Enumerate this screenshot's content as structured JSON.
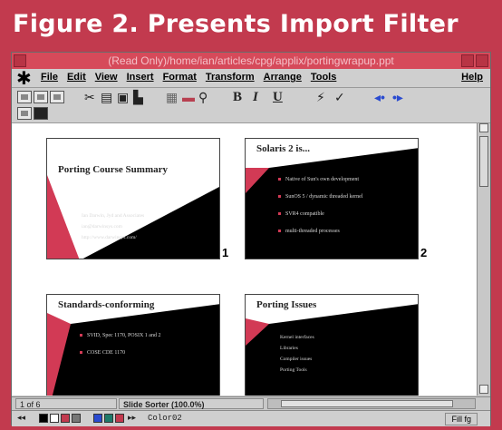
{
  "figure": {
    "title": "Figure 2. Presents Import Filter"
  },
  "window": {
    "title": "(Read Only)/home/ian/articles/cpg/applix/portingwrapup.ppt"
  },
  "menubar": {
    "items": [
      "File",
      "Edit",
      "View",
      "Insert",
      "Format",
      "Transform",
      "Arrange",
      "Tools"
    ],
    "help": "Help"
  },
  "toolbar": {
    "bold": "B",
    "italic": "I",
    "underline": "U"
  },
  "slides": [
    {
      "number": "1",
      "title": "Porting Course Summary",
      "lines": [
        "Ian Darwin, Jyd and Associates",
        "ian@darwinsys.com",
        "http://www.darwinsys.com/"
      ]
    },
    {
      "number": "2",
      "title": "Solaris 2 is...",
      "bullets": [
        "Native of Sun's own development",
        "SunOS 5 / dynamic threaded kernel",
        "SVR4 compatible",
        "multi-threaded processes"
      ]
    },
    {
      "number": "",
      "title": "Standards-conforming",
      "bullets": [
        "SVID, Spec 1170, POSIX 1 and 2",
        "COSE CDE 1170"
      ]
    },
    {
      "number": "",
      "title": "Porting Issues",
      "lines": [
        "Kernel interfaces",
        "Libraries",
        "Compiler issues",
        "Porting Tools"
      ]
    }
  ],
  "status": {
    "page": "1 of 6",
    "view": "Slide Sorter (100.0%)"
  },
  "bottombar": {
    "color_label": "Color02",
    "fill_label": "Fill fg"
  },
  "colors": {
    "page_background": "#c23a4e",
    "title_bar": "#d64a5a",
    "slide_accent": "#d23a55",
    "slide_dark": "#000000"
  }
}
